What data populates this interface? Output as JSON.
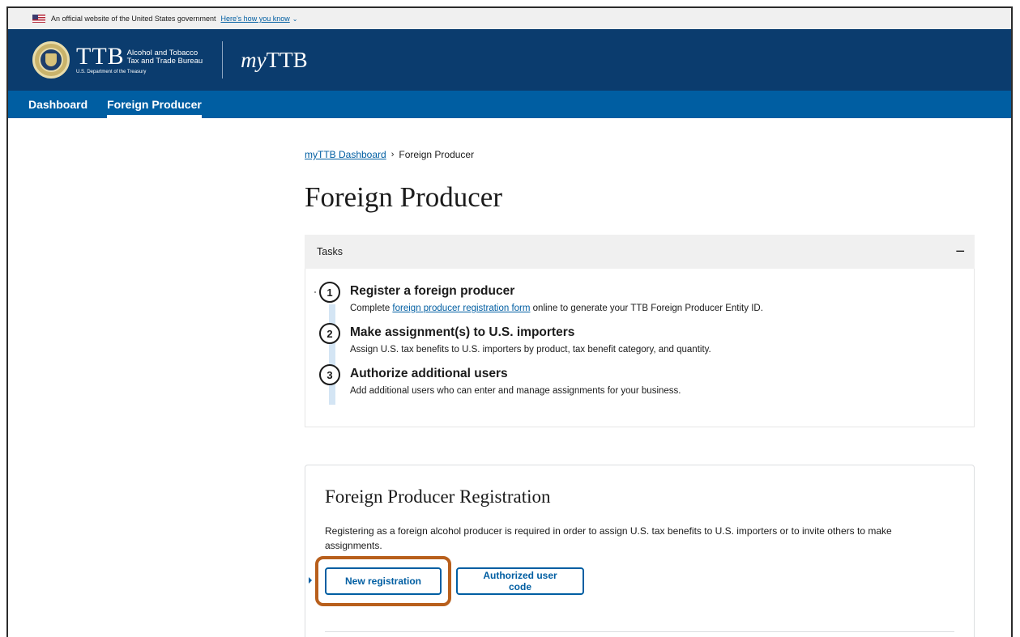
{
  "gov_banner": {
    "text": "An official website of the United States government",
    "link": "Here's how you know"
  },
  "header": {
    "agency_letters": "TTB",
    "agency_line1": "Alcohol and Tobacco",
    "agency_line2": "Tax and Trade Bureau",
    "department": "U.S. Department of the Treasury",
    "app_prefix": "my",
    "app_name": "TTB"
  },
  "nav": {
    "items": [
      {
        "label": "Dashboard"
      },
      {
        "label": "Foreign Producer"
      }
    ]
  },
  "breadcrumb": {
    "link": "myTTB Dashboard",
    "current": "Foreign Producer"
  },
  "page_title": "Foreign Producer",
  "tasks": {
    "heading": "Tasks",
    "toggle": "−",
    "steps": [
      {
        "number": "1",
        "title": "Register a foreign producer",
        "desc_before": "Complete ",
        "desc_link": "foreign producer registration form",
        "desc_after": " online to generate your TTB Foreign Producer Entity ID."
      },
      {
        "number": "2",
        "title": "Make assignment(s) to U.S. importers",
        "desc": "Assign U.S. tax benefits to U.S. importers by product, tax benefit category, and quantity."
      },
      {
        "number": "3",
        "title": "Authorize additional users",
        "desc": "Add additional users who can enter and manage assignments for your business."
      }
    ]
  },
  "registration": {
    "title": "Foreign Producer Registration",
    "description": "Registering as a foreign alcohol producer is required in order to assign U.S. tax benefits to U.S. importers or to invite others to make assignments.",
    "new_button": "New registration",
    "auth_button": "Authorized user code"
  },
  "colors": {
    "header_bg": "#0b3c6e",
    "nav_bg": "#005ea2",
    "link": "#005ea2",
    "highlight": "#b85f1c"
  }
}
